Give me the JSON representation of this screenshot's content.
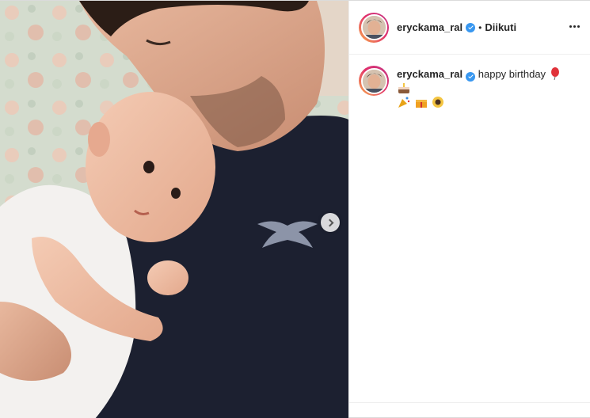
{
  "post": {
    "author": {
      "username": "eryckama_ral",
      "verified": true,
      "follow_label": "Diikuti",
      "separator": "•"
    },
    "caption": {
      "username": "eryckama_ral",
      "text": "happy birthday",
      "emojis": [
        "balloon-emoji",
        "cake-emoji",
        "party-popper-emoji",
        "gift-emoji",
        "sunflower-emoji"
      ]
    },
    "carousel": {
      "next_icon": "chevron-right-icon"
    }
  },
  "colors": {
    "verified": "#3897f0",
    "story_ring_start": "#f9b04b",
    "story_ring_end": "#c13584",
    "shirt": "#1c2030"
  }
}
